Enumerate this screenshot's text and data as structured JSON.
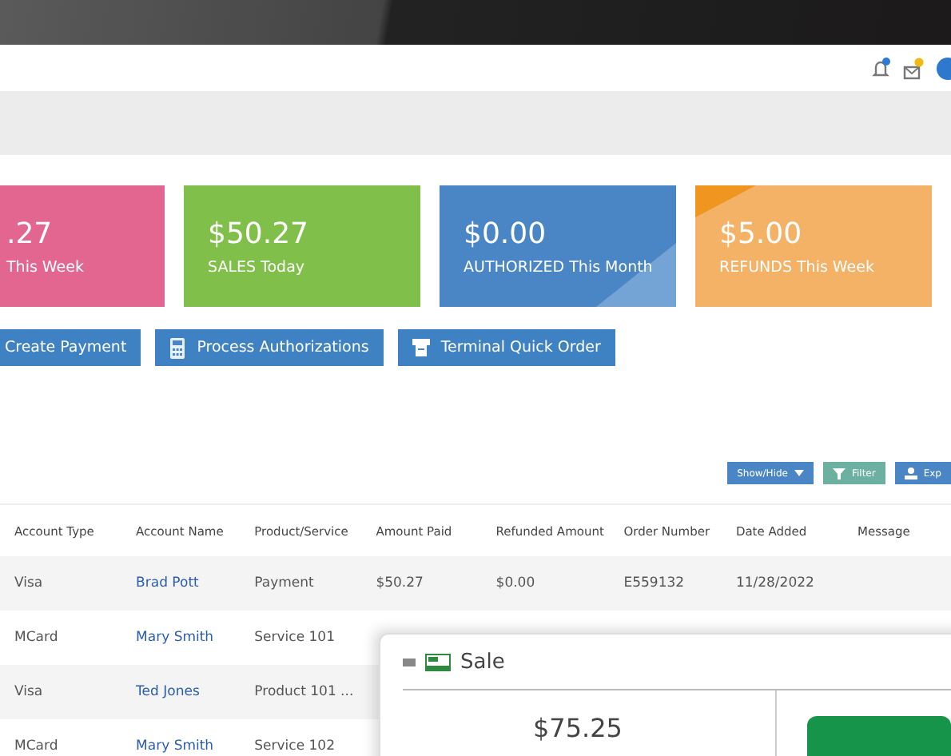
{
  "header": {
    "notification_count": true,
    "message_count": true
  },
  "stat_cards": [
    {
      "amount": ".27",
      "label": "This Week",
      "color": "#e2668f"
    },
    {
      "amount": "$50.27",
      "label": "SALES Today",
      "color": "#80bf49"
    },
    {
      "amount": "$0.00",
      "label": "AUTHORIZED This Month",
      "color": "#4a86c6"
    },
    {
      "amount": "$5.00",
      "label": "REFUNDS This Week",
      "color": "#f4b267"
    }
  ],
  "actions": [
    {
      "label": "Create Payment"
    },
    {
      "label": "Process Authorizations"
    },
    {
      "label": "Terminal Quick Order"
    }
  ],
  "table_tools": [
    {
      "label": "Show/Hide",
      "kind": "dropdown"
    },
    {
      "label": "Filter",
      "kind": "filter"
    },
    {
      "label": "Exp",
      "kind": "export"
    }
  ],
  "table": {
    "columns": [
      "Account Type",
      "Account Name",
      "Product/Service",
      "Amount Paid",
      "Refunded Amount",
      "Order Number",
      "Date Added",
      "Message"
    ],
    "rows": [
      {
        "account_type": "Visa",
        "account_name": "Brad Pott",
        "product_service": "Payment",
        "amount_paid": "$50.27",
        "refunded_amount": "$0.00",
        "order_number": "E559132",
        "date_added": "11/28/2022"
      },
      {
        "account_type": "MCard",
        "account_name": "Mary Smith",
        "product_service": "Service 101"
      },
      {
        "account_type": "Visa",
        "account_name": "Ted Jones",
        "product_service": "Product 101 ..."
      },
      {
        "account_type": "MCard",
        "account_name": "Mary Smith",
        "product_service": "Service 102"
      }
    ]
  },
  "sale_window": {
    "title": "Sale",
    "amount": "$75.25"
  }
}
